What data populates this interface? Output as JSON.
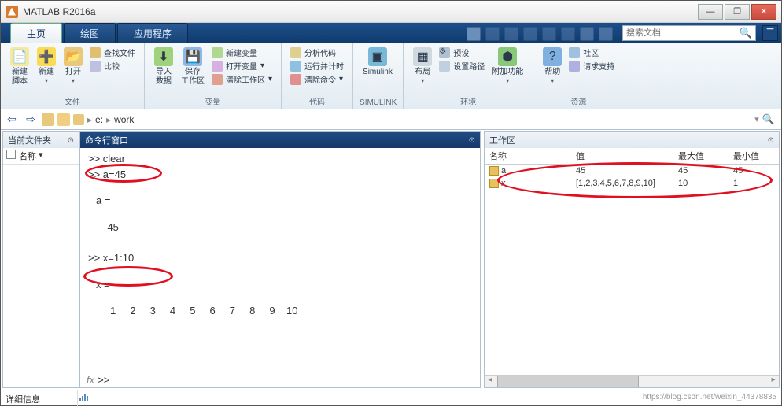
{
  "titlebar": {
    "title": "MATLAB R2016a"
  },
  "winbtns": {
    "min": "—",
    "max": "❐",
    "close": "✕"
  },
  "tabs": [
    {
      "label": "主页"
    },
    {
      "label": "绘图"
    },
    {
      "label": "应用程序"
    }
  ],
  "searchdoc": {
    "placeholder": "搜索文档"
  },
  "ribbon": {
    "file": {
      "label": "文件",
      "newscript": "新建\n脚本",
      "new": "新建",
      "open": "打开",
      "find": "查找文件",
      "compare": "比较"
    },
    "var": {
      "label": "变量",
      "import": "导入\n数据",
      "save": "保存\n工作区",
      "newvar": "新建变量",
      "openvar": "打开变量",
      "clear": "清除工作区"
    },
    "code": {
      "label": "代码",
      "analyze": "分析代码",
      "runtime": "运行并计时",
      "clearcmd": "清除命令"
    },
    "simulink": {
      "label": "SIMULINK",
      "btn": "Simulink"
    },
    "env": {
      "label": "环境",
      "layout": "布局",
      "pref": "预设",
      "path": "设置路径",
      "addon": "附加功能"
    },
    "res": {
      "label": "资源",
      "help": "帮助",
      "comm": "社区",
      "support": "请求支持"
    }
  },
  "addr": {
    "drive": "e:",
    "folder": "work"
  },
  "panels": {
    "currentfolder": "当前文件夹",
    "namecol": "名称",
    "cmdwin": "命令行窗口",
    "workspace": "工作区",
    "details": "详细信息"
  },
  "cmd": {
    "l1": ">> clear",
    "l2": ">> a=45",
    "l3": "a =",
    "l4": "    45",
    "l5": ">> x=1:10",
    "l6": "x =",
    "l7": "     1     2     3     4     5     6     7     8     9    10",
    "fx": "fx",
    "prompt": ">> "
  },
  "ws": {
    "cols": [
      "名称",
      "值",
      "最大值",
      "最小值"
    ],
    "rows": [
      {
        "name": "a",
        "val": "45",
        "max": "45",
        "min": "45"
      },
      {
        "name": "x",
        "val": "[1,2,3,4,5,6,7,8,9,10]",
        "max": "10",
        "min": "1"
      }
    ]
  },
  "watermark": "https://blog.csdn.net/weixin_44378835"
}
